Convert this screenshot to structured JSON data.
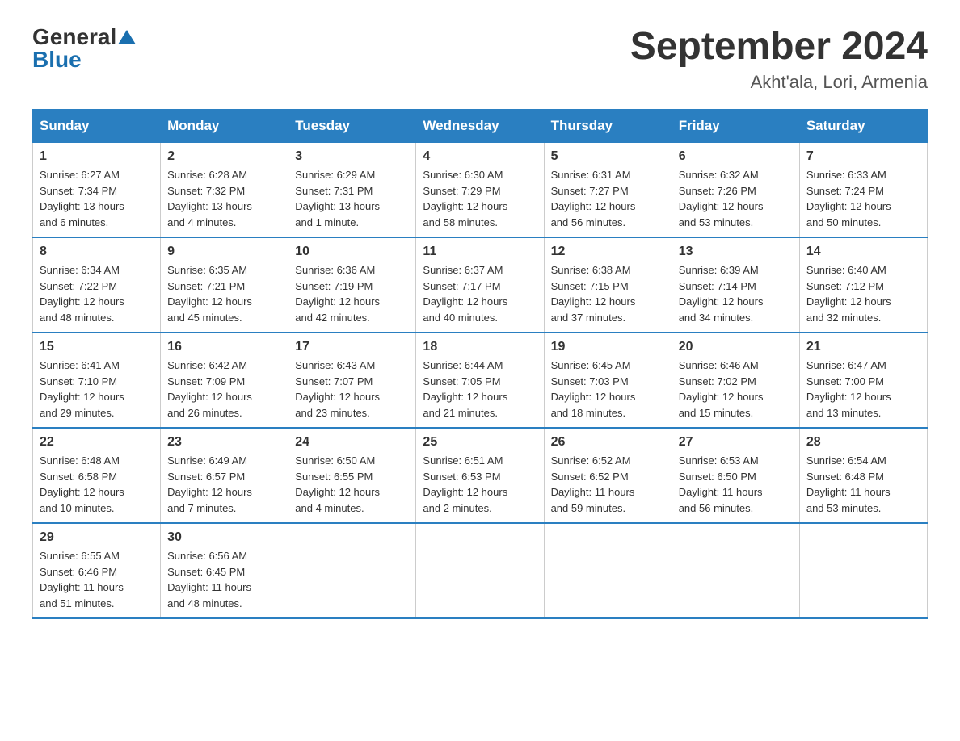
{
  "logo": {
    "general": "General",
    "blue": "Blue"
  },
  "title": {
    "month_year": "September 2024",
    "location": "Akht'ala, Lori, Armenia"
  },
  "headers": [
    "Sunday",
    "Monday",
    "Tuesday",
    "Wednesday",
    "Thursday",
    "Friday",
    "Saturday"
  ],
  "weeks": [
    [
      {
        "day": "1",
        "sunrise": "6:27 AM",
        "sunset": "7:34 PM",
        "daylight": "13 hours and 6 minutes."
      },
      {
        "day": "2",
        "sunrise": "6:28 AM",
        "sunset": "7:32 PM",
        "daylight": "13 hours and 4 minutes."
      },
      {
        "day": "3",
        "sunrise": "6:29 AM",
        "sunset": "7:31 PM",
        "daylight": "13 hours and 1 minute."
      },
      {
        "day": "4",
        "sunrise": "6:30 AM",
        "sunset": "7:29 PM",
        "daylight": "12 hours and 58 minutes."
      },
      {
        "day": "5",
        "sunrise": "6:31 AM",
        "sunset": "7:27 PM",
        "daylight": "12 hours and 56 minutes."
      },
      {
        "day": "6",
        "sunrise": "6:32 AM",
        "sunset": "7:26 PM",
        "daylight": "12 hours and 53 minutes."
      },
      {
        "day": "7",
        "sunrise": "6:33 AM",
        "sunset": "7:24 PM",
        "daylight": "12 hours and 50 minutes."
      }
    ],
    [
      {
        "day": "8",
        "sunrise": "6:34 AM",
        "sunset": "7:22 PM",
        "daylight": "12 hours and 48 minutes."
      },
      {
        "day": "9",
        "sunrise": "6:35 AM",
        "sunset": "7:21 PM",
        "daylight": "12 hours and 45 minutes."
      },
      {
        "day": "10",
        "sunrise": "6:36 AM",
        "sunset": "7:19 PM",
        "daylight": "12 hours and 42 minutes."
      },
      {
        "day": "11",
        "sunrise": "6:37 AM",
        "sunset": "7:17 PM",
        "daylight": "12 hours and 40 minutes."
      },
      {
        "day": "12",
        "sunrise": "6:38 AM",
        "sunset": "7:15 PM",
        "daylight": "12 hours and 37 minutes."
      },
      {
        "day": "13",
        "sunrise": "6:39 AM",
        "sunset": "7:14 PM",
        "daylight": "12 hours and 34 minutes."
      },
      {
        "day": "14",
        "sunrise": "6:40 AM",
        "sunset": "7:12 PM",
        "daylight": "12 hours and 32 minutes."
      }
    ],
    [
      {
        "day": "15",
        "sunrise": "6:41 AM",
        "sunset": "7:10 PM",
        "daylight": "12 hours and 29 minutes."
      },
      {
        "day": "16",
        "sunrise": "6:42 AM",
        "sunset": "7:09 PM",
        "daylight": "12 hours and 26 minutes."
      },
      {
        "day": "17",
        "sunrise": "6:43 AM",
        "sunset": "7:07 PM",
        "daylight": "12 hours and 23 minutes."
      },
      {
        "day": "18",
        "sunrise": "6:44 AM",
        "sunset": "7:05 PM",
        "daylight": "12 hours and 21 minutes."
      },
      {
        "day": "19",
        "sunrise": "6:45 AM",
        "sunset": "7:03 PM",
        "daylight": "12 hours and 18 minutes."
      },
      {
        "day": "20",
        "sunrise": "6:46 AM",
        "sunset": "7:02 PM",
        "daylight": "12 hours and 15 minutes."
      },
      {
        "day": "21",
        "sunrise": "6:47 AM",
        "sunset": "7:00 PM",
        "daylight": "12 hours and 13 minutes."
      }
    ],
    [
      {
        "day": "22",
        "sunrise": "6:48 AM",
        "sunset": "6:58 PM",
        "daylight": "12 hours and 10 minutes."
      },
      {
        "day": "23",
        "sunrise": "6:49 AM",
        "sunset": "6:57 PM",
        "daylight": "12 hours and 7 minutes."
      },
      {
        "day": "24",
        "sunrise": "6:50 AM",
        "sunset": "6:55 PM",
        "daylight": "12 hours and 4 minutes."
      },
      {
        "day": "25",
        "sunrise": "6:51 AM",
        "sunset": "6:53 PM",
        "daylight": "12 hours and 2 minutes."
      },
      {
        "day": "26",
        "sunrise": "6:52 AM",
        "sunset": "6:52 PM",
        "daylight": "11 hours and 59 minutes."
      },
      {
        "day": "27",
        "sunrise": "6:53 AM",
        "sunset": "6:50 PM",
        "daylight": "11 hours and 56 minutes."
      },
      {
        "day": "28",
        "sunrise": "6:54 AM",
        "sunset": "6:48 PM",
        "daylight": "11 hours and 53 minutes."
      }
    ],
    [
      {
        "day": "29",
        "sunrise": "6:55 AM",
        "sunset": "6:46 PM",
        "daylight": "11 hours and 51 minutes."
      },
      {
        "day": "30",
        "sunrise": "6:56 AM",
        "sunset": "6:45 PM",
        "daylight": "11 hours and 48 minutes."
      },
      null,
      null,
      null,
      null,
      null
    ]
  ],
  "labels": {
    "sunrise": "Sunrise:",
    "sunset": "Sunset:",
    "daylight": "Daylight:"
  }
}
